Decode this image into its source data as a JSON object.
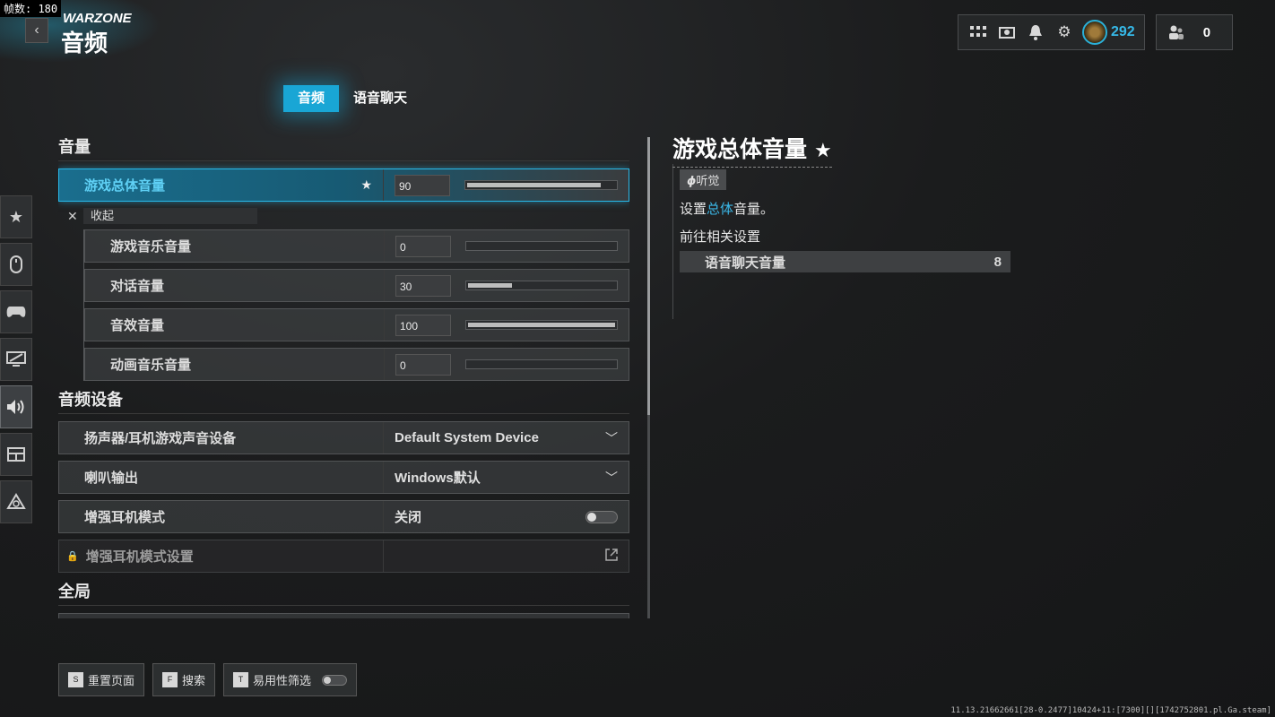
{
  "fps_overlay": "帧数: 180",
  "header": {
    "brand": "WARZONE",
    "title": "音频"
  },
  "topbar": {
    "coins": "292",
    "friends_count": "0"
  },
  "tabs": [
    {
      "label": "音频",
      "active": true
    },
    {
      "label": "语音聊天",
      "active": false
    }
  ],
  "sections": {
    "volume": {
      "title": "音量",
      "master": {
        "label": "游戏总体音量",
        "value": "90",
        "level": 0.9
      },
      "collapse_label": "收起",
      "sub": [
        {
          "label": "游戏音乐音量",
          "value": "0",
          "level": 0.0
        },
        {
          "label": "对话音量",
          "value": "30",
          "level": 0.3
        },
        {
          "label": "音效音量",
          "value": "100",
          "level": 1.0
        },
        {
          "label": "动画音乐音量",
          "value": "0",
          "level": 0.0
        }
      ]
    },
    "devices": {
      "title": "音频设备",
      "speaker_device": {
        "label": "扬声器/耳机游戏声音设备",
        "value": "Default System Device"
      },
      "speaker_output": {
        "label": "喇叭输出",
        "value": "Windows默认"
      },
      "enhanced_mode": {
        "label": "增强耳机模式",
        "value": "关闭"
      },
      "enhanced_settings": {
        "label": "增强耳机模式设置"
      }
    },
    "global": {
      "title": "全局"
    }
  },
  "detail": {
    "title": "游戏总体音量",
    "tag": "听觉",
    "desc_pre": "设置",
    "desc_hl": "总体",
    "desc_post": "音量。",
    "goto": "前往相关设置",
    "related": {
      "label": "语音聊天音量",
      "value": "8"
    }
  },
  "bottom": {
    "reset": {
      "key": "S",
      "label": "重置页面"
    },
    "search": {
      "key": "F",
      "label": "搜索"
    },
    "accessibility": {
      "key": "T",
      "label": "易用性筛选"
    }
  },
  "build_info": "11.13.21662661[28-0.2477]10424+11:[7300][][1742752801.pl.Ga.steam]",
  "colors": {
    "accent": "#19a6d5",
    "highlight_text": "#5fd0f5"
  }
}
